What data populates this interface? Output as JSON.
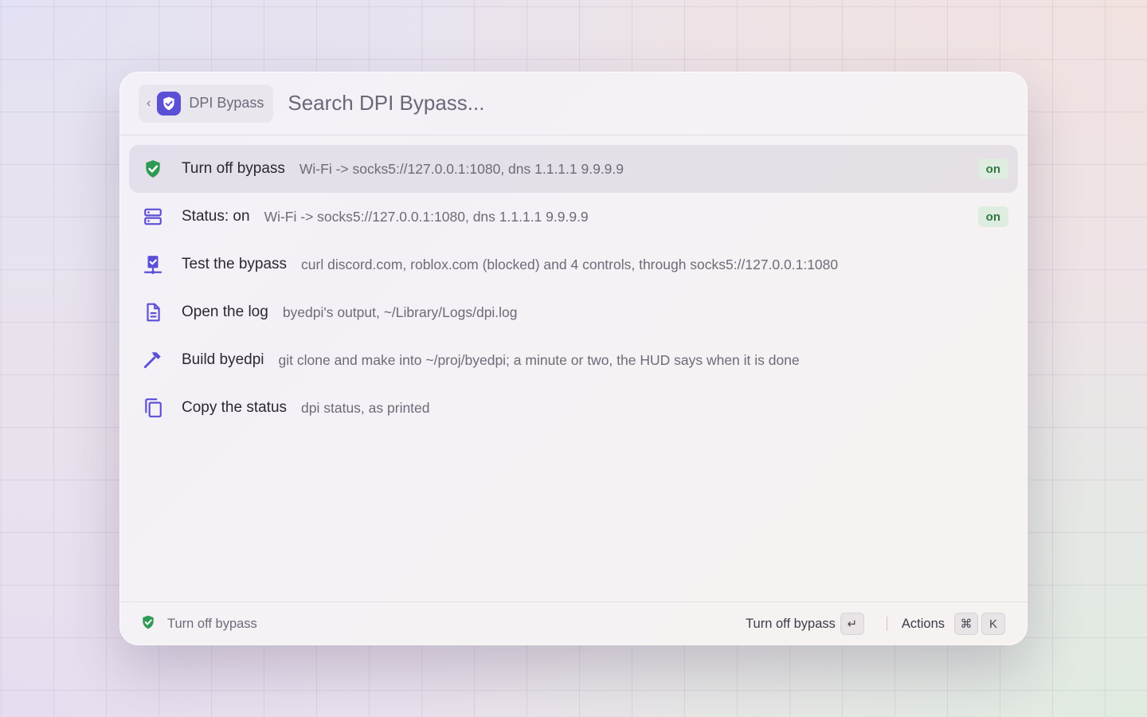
{
  "breadcrumb": {
    "back_glyph": "‹",
    "app_name": "DPI Bypass",
    "app_icon": "shield-check-icon"
  },
  "search": {
    "placeholder": "Search DPI Bypass...",
    "value": ""
  },
  "items": [
    {
      "title": "Turn off bypass",
      "subtitle": "Wi-Fi -> socks5://127.0.0.1:1080, dns 1.1.1.1 9.9.9.9",
      "badge": "on",
      "icon": "shield-check-icon",
      "selected": true
    },
    {
      "title": "Status: on",
      "subtitle": "Wi-Fi -> socks5://127.0.0.1:1080, dns 1.1.1.1 9.9.9.9",
      "badge": "on",
      "icon": "server-icon"
    },
    {
      "title": "Test the bypass",
      "subtitle": "curl discord.com, roblox.com (blocked) and 4 controls, through socks5://127.0.0.1:1080",
      "icon": "network-check-icon"
    },
    {
      "title": "Open the log",
      "subtitle": "byedpi's output, ~/Library/Logs/dpi.log",
      "icon": "document-icon"
    },
    {
      "title": "Build byedpi",
      "subtitle": "git clone and make into ~/proj/byedpi; a minute or two, the HUD says when it is done",
      "icon": "hammer-icon"
    },
    {
      "title": "Copy the status",
      "subtitle": "dpi status, as printed",
      "icon": "copy-icon"
    }
  ],
  "footer": {
    "selected_label": "Turn off bypass",
    "primary_action": "Turn off bypass",
    "enter_key": "↵",
    "actions_label": "Actions",
    "cmd_key": "⌘",
    "k_key": "K"
  },
  "colors": {
    "accent": "#5b4fd6",
    "green": "#2f9a55",
    "badge_bg": "#dfece0"
  }
}
